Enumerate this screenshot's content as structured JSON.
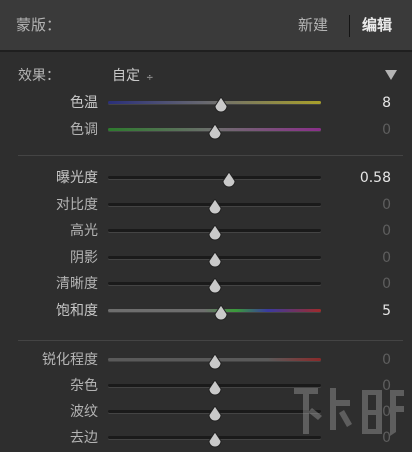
{
  "header": {
    "title": "蒙版：",
    "tab_new": "新建",
    "tab_edit": "编辑"
  },
  "effect": {
    "label": "效果：",
    "value": "自定",
    "updown_glyph": "÷",
    "disclose_glyph": "▼"
  },
  "sliders": [
    {
      "key": "temp",
      "label": "色温",
      "value": "8",
      "pos": 0.53,
      "track": "linear-gradient(90deg,#2a2f7a,#6e6e6e 50%,#a8a02a)",
      "active": true
    },
    {
      "key": "tint",
      "label": "色调",
      "value": "0",
      "pos": 0.5,
      "track": "linear-gradient(90deg,#2d7a2d,#6e6e6e 50%,#8a2f8a)",
      "active": false
    },
    {
      "key": "exposure",
      "label": "曝光度",
      "value": "0.58",
      "pos": 0.57,
      "track": "",
      "active": true
    },
    {
      "key": "contrast",
      "label": "对比度",
      "value": "0",
      "pos": 0.5,
      "track": "",
      "active": false
    },
    {
      "key": "highlights",
      "label": "高光",
      "value": "0",
      "pos": 0.5,
      "track": "",
      "active": false
    },
    {
      "key": "shadows",
      "label": "阴影",
      "value": "0",
      "pos": 0.5,
      "track": "",
      "active": false
    },
    {
      "key": "clarity",
      "label": "清晰度",
      "value": "0",
      "pos": 0.5,
      "track": "",
      "active": false
    },
    {
      "key": "saturation",
      "label": "饱和度",
      "value": "5",
      "pos": 0.53,
      "track": "linear-gradient(90deg,#6e6e6e,#6e6e6e 45%,#3a9a3a 60%,#3a3aa0 75%,#a02a2a)",
      "active": true
    },
    {
      "key": "sharpness",
      "label": "锐化程度",
      "value": "0",
      "pos": 0.5,
      "track": "linear-gradient(90deg,#5a5a5a,#5a5a5a 75%,#8a2a2a)",
      "active": false
    },
    {
      "key": "noise",
      "label": "杂色",
      "value": "0",
      "pos": 0.5,
      "track": "",
      "active": false
    },
    {
      "key": "moire",
      "label": "波纹",
      "value": "0",
      "pos": 0.5,
      "track": "",
      "active": false
    },
    {
      "key": "defringe",
      "label": "去边",
      "value": "0",
      "pos": 0.5,
      "track": "",
      "active": false
    }
  ],
  "watermark": {
    "text": "下载吧",
    "url": "www.xiazaiba.com"
  }
}
